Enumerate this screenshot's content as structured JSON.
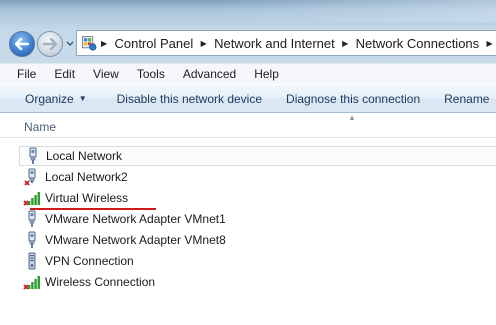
{
  "address": {
    "breadcrumbs": [
      "Control Panel",
      "Network and Internet",
      "Network Connections"
    ]
  },
  "menu": [
    "File",
    "Edit",
    "View",
    "Tools",
    "Advanced",
    "Help"
  ],
  "commands": {
    "organize": "Organize",
    "disable": "Disable this network device",
    "diagnose": "Diagnose this connection",
    "rename": "Rename"
  },
  "columns": {
    "name": "Name"
  },
  "connections": [
    {
      "name": "Local Network",
      "icon": "wired-network-icon"
    },
    {
      "name": "Local Network2",
      "icon": "wired-network-disconnected-icon"
    },
    {
      "name": "Virtual Wireless",
      "icon": "wireless-disconnected-icon"
    },
    {
      "name": "VMware Network Adapter VMnet1",
      "icon": "wired-network-icon"
    },
    {
      "name": "VMware Network Adapter VMnet8",
      "icon": "wired-network-icon"
    },
    {
      "name": "VPN Connection",
      "icon": "vpn-icon"
    },
    {
      "name": "Wireless Connection",
      "icon": "wireless-disconnected-icon"
    }
  ],
  "colors": {
    "highlight_underline": "#cc1b1b",
    "command_text": "#1e395b"
  }
}
